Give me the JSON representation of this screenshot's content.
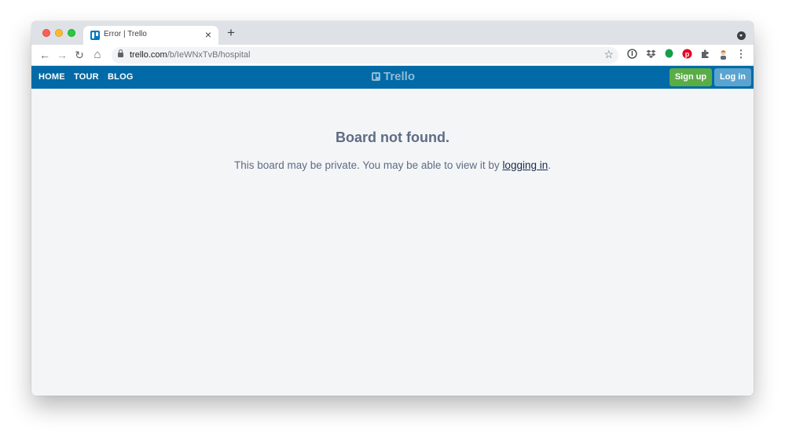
{
  "browser": {
    "tab": {
      "title": "Error | Trello",
      "close_glyph": "×",
      "favicon": "trello-icon"
    },
    "new_tab_glyph": "+",
    "address": {
      "host": "trello.com",
      "path": "/b/IeWNxTvB/hospital"
    },
    "nav": {
      "back": "←",
      "forward": "→",
      "reload": "↻",
      "home": "⌂"
    },
    "extensions": [
      "info-icon",
      "dropbox-icon",
      "evernote-icon",
      "pinterest-icon",
      "puzzle-icon",
      "profile-avatar",
      "menu-icon"
    ]
  },
  "header": {
    "nav_items": [
      "HOME",
      "TOUR",
      "BLOG"
    ],
    "logo_text": "Trello",
    "signup_label": "Sign up",
    "login_label": "Log in",
    "colors": {
      "bar": "#026aa7",
      "signup": "#5aac44",
      "login": "#5ba4cf"
    }
  },
  "main": {
    "title": "Board not found.",
    "message_before": "This board may be private. You may be able to view it by ",
    "link_text": "logging in",
    "message_after": "."
  }
}
